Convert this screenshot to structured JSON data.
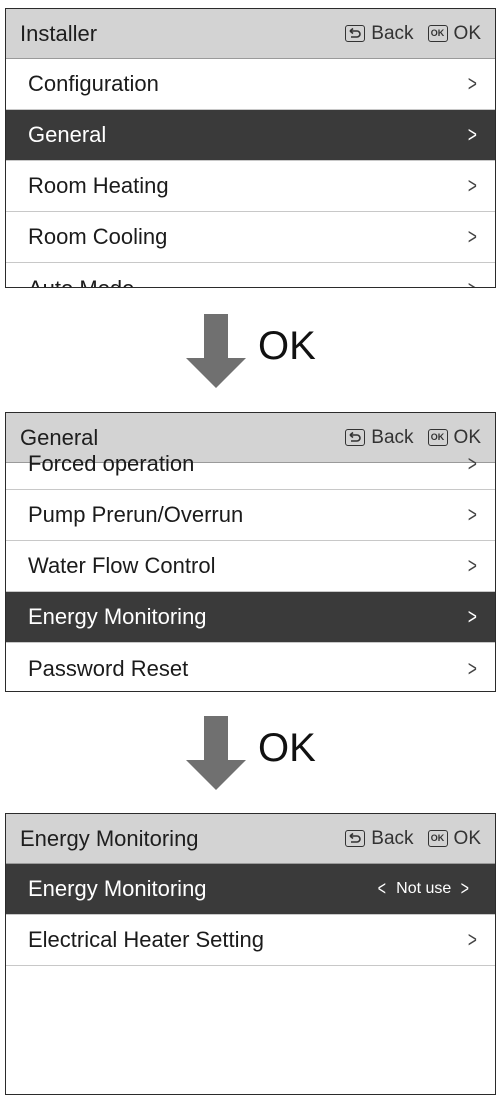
{
  "header_buttons": {
    "back": "Back",
    "ok": "OK",
    "ok_icon": "OK"
  },
  "arrow_label": "OK",
  "screens": [
    {
      "title": "Installer",
      "rows": [
        {
          "label": "Configuration",
          "selected": false
        },
        {
          "label": "General",
          "selected": true
        },
        {
          "label": "Room Heating",
          "selected": false
        },
        {
          "label": "Room Cooling",
          "selected": false
        },
        {
          "label": "Auto Mode",
          "selected": false
        }
      ]
    },
    {
      "title": "General",
      "rows": [
        {
          "label": "Forced operation",
          "selected": false
        },
        {
          "label": "Pump Prerun/Overrun",
          "selected": false
        },
        {
          "label": "Water Flow Control",
          "selected": false
        },
        {
          "label": "Energy Monitoring",
          "selected": true
        },
        {
          "label": "Password Reset",
          "selected": false
        }
      ]
    },
    {
      "title": "Energy Monitoring",
      "rows": [
        {
          "label": "Energy Monitoring",
          "value": "Not use",
          "selected": true
        },
        {
          "label": "Electrical Heater Setting",
          "selected": false
        }
      ]
    }
  ],
  "colors": {
    "header_bg": "#d3d3d3",
    "selected_bg": "#3a3a3a",
    "arrow": "#707070"
  }
}
